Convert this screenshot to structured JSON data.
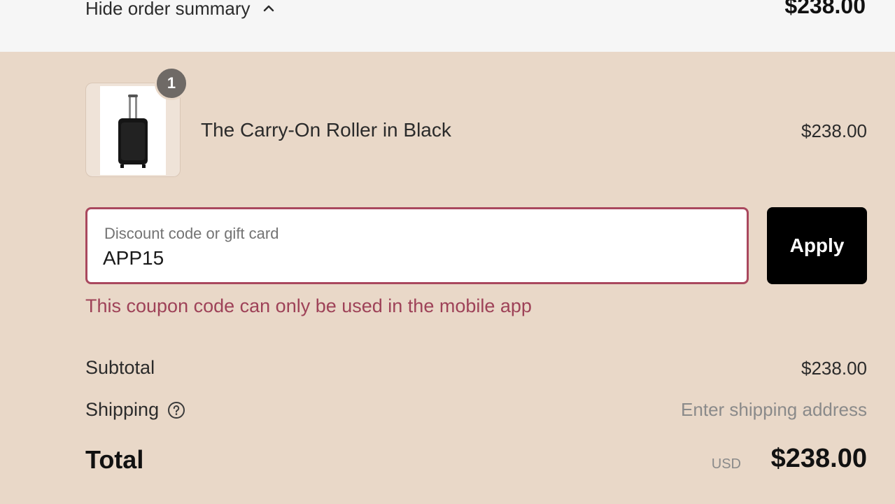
{
  "summary_toggle": {
    "label": "Hide order summary",
    "icon": "chevron-up-icon",
    "total": "$238.00"
  },
  "line_items": [
    {
      "name": "The Carry-On Roller in Black",
      "price": "$238.00",
      "quantity": "1",
      "image_icon": "carry-on-suitcase-image"
    }
  ],
  "discount": {
    "placeholder": "Discount code or gift card",
    "value": "APP15",
    "apply_label": "Apply",
    "error": "This coupon code can only be used in the mobile app"
  },
  "totals": {
    "subtotal_label": "Subtotal",
    "subtotal_value": "$238.00",
    "shipping_label": "Shipping",
    "shipping_value": "Enter shipping address",
    "shipping_help_icon": "question-circle-icon",
    "total_label": "Total",
    "currency": "USD",
    "total_value": "$238.00"
  },
  "colors": {
    "panel_background": "#e9d8c8",
    "top_bar_background": "#f6f6f6",
    "error": "#9e4258",
    "button_background": "#000000"
  }
}
